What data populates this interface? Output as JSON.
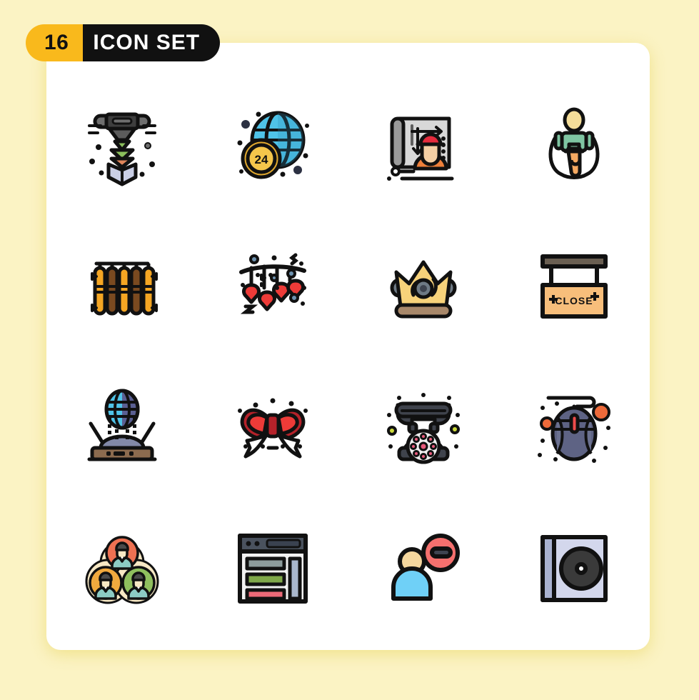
{
  "page": {
    "background_color": "#FBF3C4",
    "card_color": "#FFFFFF"
  },
  "header": {
    "count": "16",
    "title": "ICON SET",
    "count_bg": "#F9B91C",
    "title_bg": "#111111",
    "count_text_color": "#111111",
    "title_text_color": "#FFFFFF"
  },
  "grid": {
    "columns": 4,
    "rows": 4,
    "total_icons": 16,
    "style": "filled line / flat",
    "icons": [
      {
        "index": 1,
        "name": "3d-printer-icon",
        "label": "3D Printer",
        "colors": [
          "#6E6E6E",
          "#3E3E3E",
          "#8BBE5C",
          "#E0855A",
          "#C9CEE5"
        ]
      },
      {
        "index": 2,
        "name": "globe-24-support-icon",
        "label": "24 Hour Global Support",
        "badge_text": "24",
        "colors": [
          "#4FC3E8",
          "#2B8CB5",
          "#F5C64B",
          "#E0A82E"
        ]
      },
      {
        "index": 3,
        "name": "blueprint-engineer-icon",
        "label": "Blueprint Engineer",
        "colors": [
          "#D8D8D8",
          "#ED7F3A",
          "#E52B3D",
          "#F4CFA4"
        ]
      },
      {
        "index": 4,
        "name": "jump-rope-icon",
        "label": "Jump Rope Exercise",
        "colors": [
          "#7FC5A2",
          "#F5A962",
          "#F5DE9A"
        ]
      },
      {
        "index": 5,
        "name": "radiator-icon",
        "label": "Radiator Heater",
        "colors": [
          "#F5A623",
          "#7A4A20"
        ]
      },
      {
        "index": 6,
        "name": "hanging-hearts-icon",
        "label": "Hanging Hearts Decoration",
        "colors": [
          "#ED3B38",
          "#111111",
          "#6E93B0"
        ]
      },
      {
        "index": 7,
        "name": "crown-icon",
        "label": "Crown",
        "colors": [
          "#F7D27A",
          "#6E7A85",
          "#A8886A"
        ]
      },
      {
        "index": 8,
        "name": "close-sign-icon",
        "label": "Close Sign",
        "sign_text": "CLOSE",
        "colors": [
          "#F7BE7B",
          "#6A5F52"
        ]
      },
      {
        "index": 9,
        "name": "wifi-router-globe-icon",
        "label": "Internet Router",
        "colors": [
          "#4FC3E8",
          "#5A5F92",
          "#8B6B4F",
          "#8289A8"
        ]
      },
      {
        "index": 10,
        "name": "ribbon-bow-icon",
        "label": "Ribbon Bow",
        "colors": [
          "#ED3B38",
          "#B5222A"
        ]
      },
      {
        "index": 11,
        "name": "rotary-telephone-icon",
        "label": "Rotary Telephone",
        "colors": [
          "#3F434C",
          "#E85A7B",
          "#CDDB3B"
        ]
      },
      {
        "index": 12,
        "name": "computer-mouse-icon",
        "label": "Computer Mouse",
        "colors": [
          "#5E6384",
          "#ED6A3A",
          "#ED4B4B"
        ]
      },
      {
        "index": 13,
        "name": "team-group-icon",
        "label": "Team Group",
        "colors": [
          "#EE7152",
          "#F0A93E",
          "#8FBF5E",
          "#F7E8C4",
          "#8CCBC4"
        ]
      },
      {
        "index": 14,
        "name": "web-layout-icon",
        "label": "Web Layout",
        "colors": [
          "#4A525E",
          "#8D9C9C",
          "#7FA84A",
          "#EC6A78"
        ]
      },
      {
        "index": 15,
        "name": "remove-user-icon",
        "label": "Remove User",
        "colors": [
          "#6FD0F7",
          "#F5D79E",
          "#F5706E",
          "#3E4450"
        ]
      },
      {
        "index": 16,
        "name": "cd-disc-case-icon",
        "label": "CD Disc Case",
        "colors": [
          "#D3D7EC",
          "#A9B2D0",
          "#3A3A3A"
        ]
      }
    ]
  }
}
